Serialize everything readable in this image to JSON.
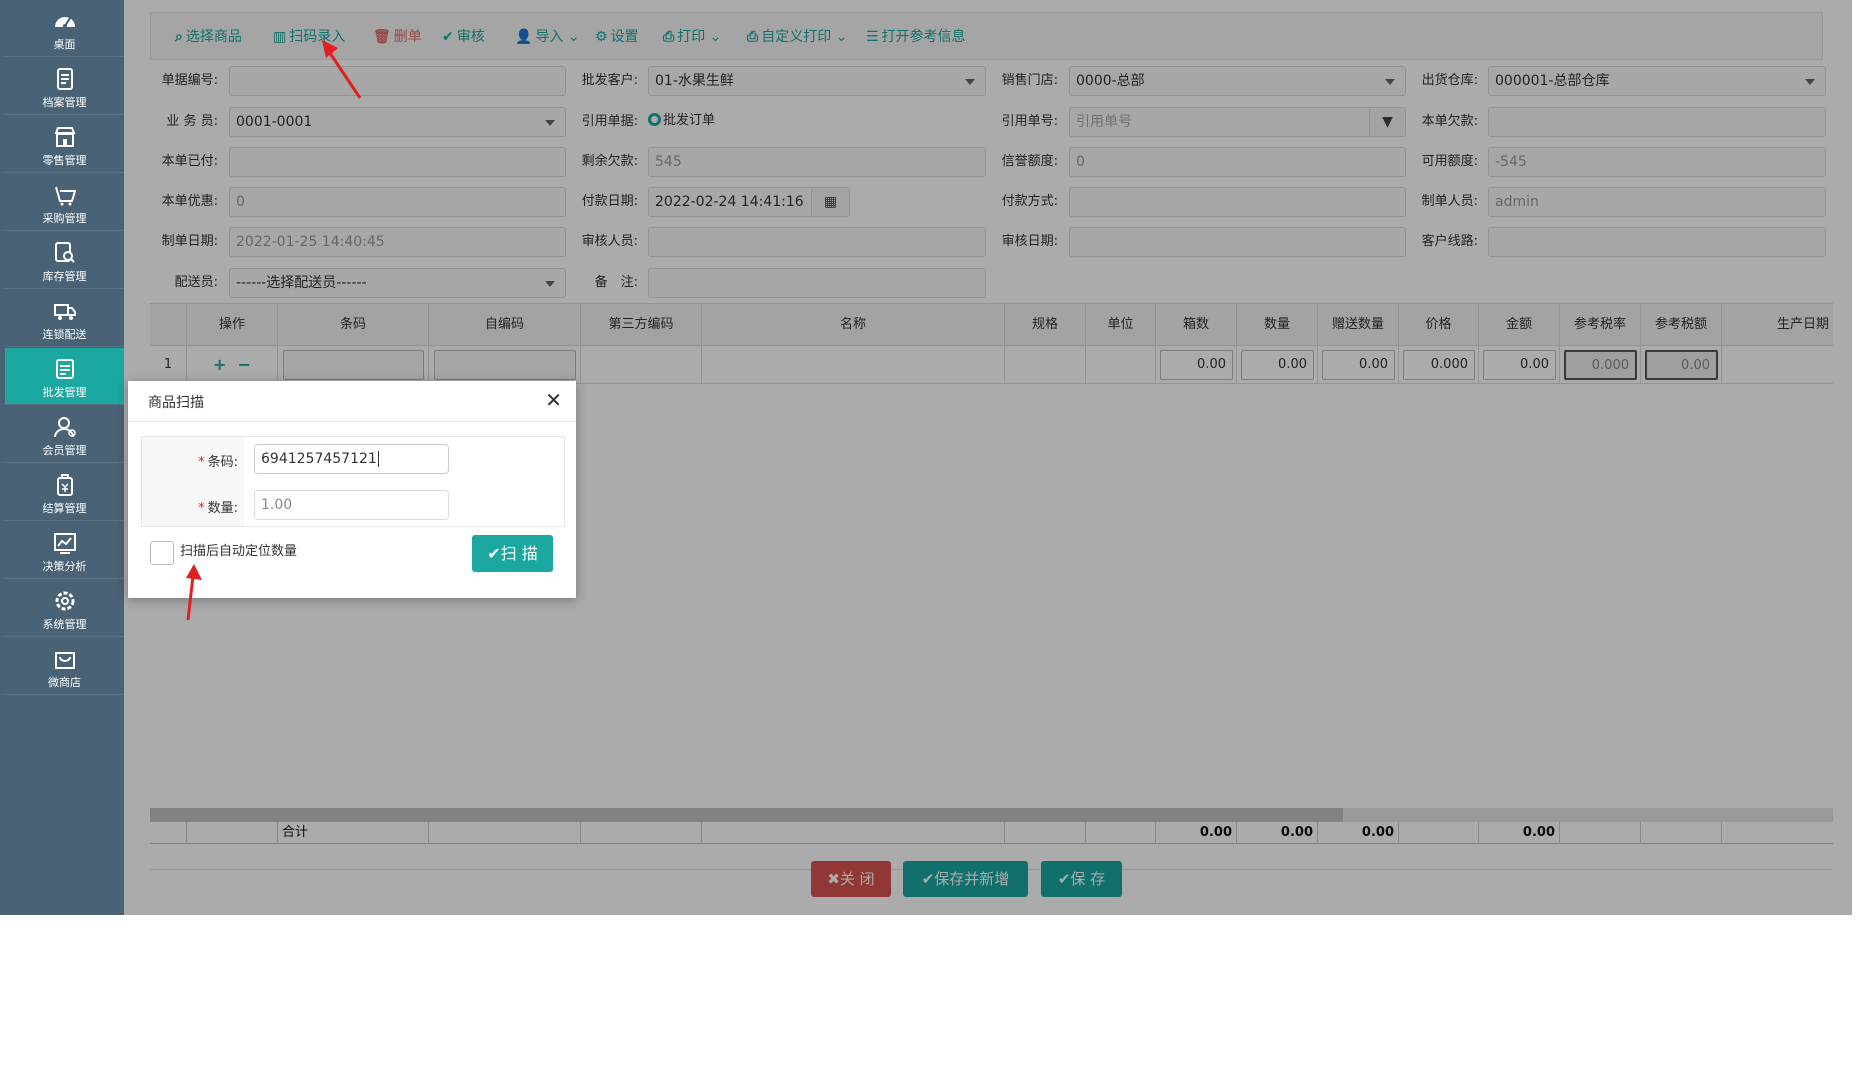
{
  "sidebar": {
    "items": [
      {
        "label": "桌面",
        "icon": "dashboard-icon"
      },
      {
        "label": "档案管理",
        "icon": "document-icon"
      },
      {
        "label": "零售管理",
        "icon": "store-icon"
      },
      {
        "label": "采购管理",
        "icon": "purchase-icon"
      },
      {
        "label": "库存管理",
        "icon": "inventory-search-icon"
      },
      {
        "label": "连锁配送",
        "icon": "delivery-icon"
      },
      {
        "label": "批发管理",
        "icon": "wholesale-icon",
        "active": true
      },
      {
        "label": "会员管理",
        "icon": "member-icon"
      },
      {
        "label": "结算管理",
        "icon": "settlement-icon"
      },
      {
        "label": "决策分析",
        "icon": "analysis-chart-icon"
      },
      {
        "label": "系统管理",
        "icon": "settings-gear-icon"
      },
      {
        "label": "微商店",
        "icon": "micro-shop-icon"
      }
    ]
  },
  "toolbar": {
    "select_goods": "选择商品",
    "scan_entry": "扫码录入",
    "delete": "删单",
    "review": "审核",
    "import": "导入",
    "settings": "设置",
    "print": "打印",
    "custom_print": "自定义打印",
    "open_ref": "打开参考信息"
  },
  "form": {
    "doc_no": {
      "label": "单据编号:",
      "value": ""
    },
    "customer": {
      "label": "批发客户:",
      "value": "01-水果生鲜"
    },
    "store": {
      "label": "销售门店:",
      "value": "0000-总部"
    },
    "warehouse": {
      "label": "出货仓库:",
      "value": "000001-总部仓库"
    },
    "salesman": {
      "label": "业 务 员:",
      "value": "0001-0001"
    },
    "ref_doc": {
      "label": "引用单据:",
      "value": "批发订单"
    },
    "ref_no": {
      "label": "引用单号:",
      "placeholder": "引用单号"
    },
    "owed": {
      "label": "本单欠款:",
      "value": ""
    },
    "paid": {
      "label": "本单已付:",
      "value": ""
    },
    "remaining": {
      "label": "剩余欠款:",
      "value": "545"
    },
    "credit": {
      "label": "信誉额度:",
      "value": "0"
    },
    "available": {
      "label": "可用额度:",
      "value": "-545"
    },
    "discount": {
      "label": "本单优惠:",
      "value": "0"
    },
    "pay_date": {
      "label": "付款日期:",
      "value": "2022-02-24 14:41:16"
    },
    "pay_method": {
      "label": "付款方式:",
      "value": ""
    },
    "maker": {
      "label": "制单人员:",
      "value": "admin"
    },
    "make_date": {
      "label": "制单日期:",
      "value": "2022-01-25 14:40:45"
    },
    "reviewer": {
      "label": "审核人员:",
      "value": ""
    },
    "review_date": {
      "label": "审核日期:",
      "value": ""
    },
    "route": {
      "label": "客户线路:",
      "value": ""
    },
    "deliverer": {
      "label": "配送员:",
      "value": "------选择配送员------"
    },
    "remark": {
      "label": "备　注:",
      "value": ""
    }
  },
  "grid": {
    "columns": [
      "操作",
      "条码",
      "自编码",
      "第三方编码",
      "名称",
      "规格",
      "单位",
      "箱数",
      "数量",
      "赠送数量",
      "价格",
      "金额",
      "参考税率",
      "参考税额",
      "生产日期"
    ],
    "row": {
      "index": "1",
      "box": "0.00",
      "qty": "0.00",
      "gift": "0.00",
      "price": "0.000",
      "amount": "0.00",
      "tax_rate": "0.000",
      "tax": "0.00"
    },
    "footer": {
      "label": "合计",
      "box": "0.00",
      "qty": "0.00",
      "gift": "0.00",
      "amount": "0.00"
    }
  },
  "buttons": {
    "close": "关 闭",
    "save_new": "保存并新增",
    "save": "保 存"
  },
  "modal": {
    "title": "商品扫描",
    "barcode_label": "条码:",
    "barcode_value": "6941257457121",
    "qty_label": "数量:",
    "qty_value": "1.00",
    "auto_locate_label": "扫描后自动定位数量",
    "scan_button": "扫 描"
  },
  "colors": {
    "accent": "#1aa8a0",
    "sidebar": "#4a6275",
    "danger": "#d9534f",
    "annotation_arrow": "#e02020"
  }
}
